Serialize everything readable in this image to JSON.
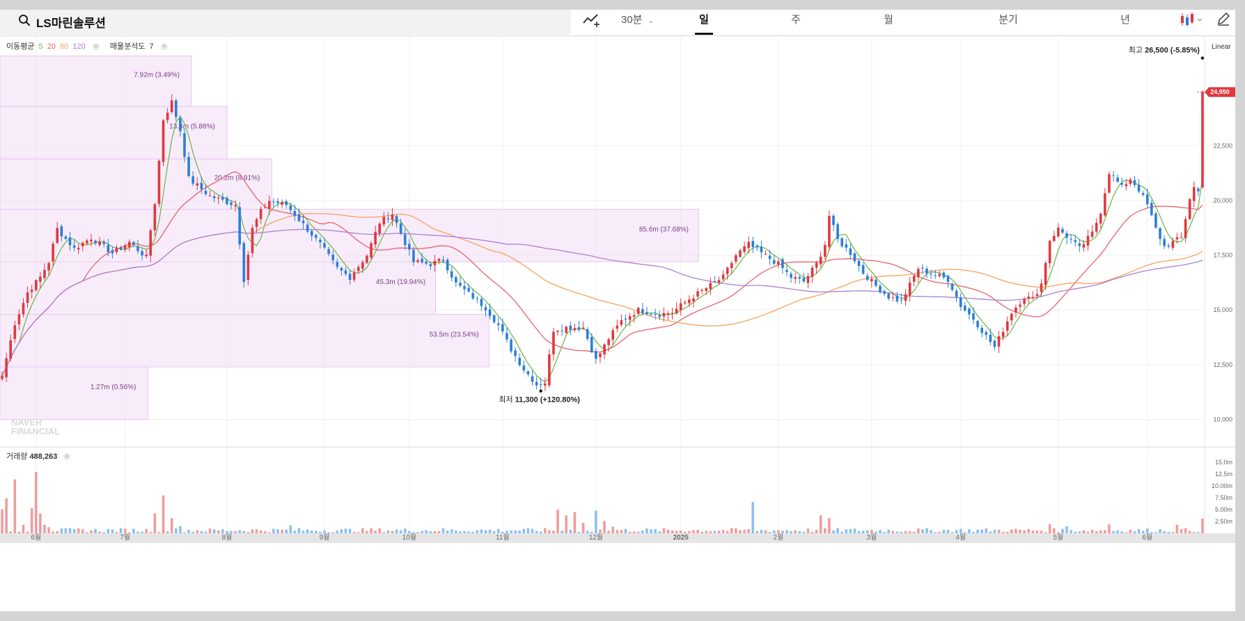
{
  "search": {
    "title": "LS마린솔루션",
    "icon": "search-icon"
  },
  "toolbar": {
    "chart_type_icon": "line-chart-icon",
    "interval": "30분",
    "periods": [
      "일",
      "주",
      "월",
      "분기",
      "년"
    ],
    "active_period": "일",
    "candle_icon": "candlestick-icon",
    "edit_icon": "pencil-icon"
  },
  "legend": {
    "ma_label": "이동평균",
    "ma_periods": [
      "5",
      "20",
      "60",
      "120"
    ],
    "profile_label": "매물분석도",
    "profile_value": "7"
  },
  "scale_label": "Linear",
  "watermark": [
    "NAVER",
    "FINANCIAL"
  ],
  "colors": {
    "up": "#e0383e",
    "down": "#2a7fd7",
    "ma5": "#6fba4e",
    "ma20": "#e8626a",
    "ma60": "#f4a35c",
    "ma120": "#ab7fd6",
    "profile": "#f3dcf6",
    "vol_up": "#ef9d9d",
    "vol_down": "#8cc0ef"
  },
  "chart_data": {
    "type": "candlestick",
    "price_ylim": [
      9000,
      27500
    ],
    "price_ticks": [
      "10,000",
      "12,500",
      "15,000",
      "17,500",
      "20,000",
      "22,500"
    ],
    "volume_ticks": [
      "2.50m",
      "5.00m",
      "7.50m",
      "10.00m",
      "12.5m",
      "15.0m"
    ],
    "volume_ylim": [
      0,
      16.5
    ],
    "x_ticks": [
      "6월",
      "7월",
      "8월",
      "9월",
      "10월",
      "11월",
      "12월",
      "2025",
      "2월",
      "3월",
      "4월",
      "5월",
      "6월"
    ],
    "current_price": "24,950",
    "high_marker": {
      "prefix": "최고",
      "value": "26,500",
      "change": "(-5.85%)",
      "price": 26500
    },
    "low_marker": {
      "prefix": "최저",
      "value": "11,300",
      "change": "(+120.80%)",
      "price": 11300
    },
    "volume_label": "거래량",
    "volume_value": "488,263",
    "volume_profile": [
      {
        "low": 10000,
        "high": 12400,
        "label": "1.27m (0.56%)",
        "share": 0.56
      },
      {
        "low": 12400,
        "high": 14800,
        "label": "53.5m (23.54%)",
        "share": 23.54
      },
      {
        "low": 14800,
        "high": 17200,
        "label": "45.3m (19.94%)",
        "share": 19.94
      },
      {
        "low": 17200,
        "high": 19600,
        "label": "85.6m (37.68%)",
        "share": 37.68
      },
      {
        "low": 19600,
        "high": 21900,
        "label": "20.2m (8.91%)",
        "share": 8.91
      },
      {
        "low": 21900,
        "high": 24300,
        "label": "13.4m (5.88%)",
        "share": 5.88
      },
      {
        "low": 24300,
        "high": 26600,
        "label": "7.92m (3.49%)",
        "share": 3.49
      }
    ],
    "price_keypoints": [
      [
        0,
        12000
      ],
      [
        3,
        14400
      ],
      [
        6,
        15800
      ],
      [
        9,
        16500
      ],
      [
        11,
        17200
      ],
      [
        13,
        18700
      ],
      [
        17,
        17800
      ],
      [
        21,
        18300
      ],
      [
        26,
        17600
      ],
      [
        30,
        18100
      ],
      [
        34,
        17400
      ],
      [
        36,
        19900
      ],
      [
        38,
        23700
      ],
      [
        40,
        24500
      ],
      [
        42,
        23200
      ],
      [
        44,
        21000
      ],
      [
        49,
        20200
      ],
      [
        55,
        19800
      ],
      [
        57,
        16400
      ],
      [
        59,
        18700
      ],
      [
        61,
        19500
      ],
      [
        63,
        20000
      ],
      [
        67,
        19800
      ],
      [
        71,
        18900
      ],
      [
        75,
        18000
      ],
      [
        79,
        16900
      ],
      [
        82,
        16500
      ],
      [
        86,
        17500
      ],
      [
        89,
        19000
      ],
      [
        92,
        19400
      ],
      [
        94,
        18500
      ],
      [
        97,
        17200
      ],
      [
        101,
        17100
      ],
      [
        104,
        17300
      ],
      [
        107,
        16200
      ],
      [
        111,
        15600
      ],
      [
        114,
        15100
      ],
      [
        117,
        14300
      ],
      [
        120,
        13200
      ],
      [
        123,
        12300
      ],
      [
        126,
        11600
      ],
      [
        128,
        11700
      ],
      [
        130,
        14100
      ],
      [
        133,
        14200
      ],
      [
        137,
        14200
      ],
      [
        140,
        12700
      ],
      [
        143,
        13700
      ],
      [
        146,
        14500
      ],
      [
        150,
        15000
      ],
      [
        155,
        14800
      ],
      [
        158,
        14900
      ],
      [
        162,
        15500
      ],
      [
        166,
        16000
      ],
      [
        170,
        16500
      ],
      [
        173,
        17500
      ],
      [
        176,
        18000
      ],
      [
        179,
        17600
      ],
      [
        183,
        17100
      ],
      [
        186,
        16500
      ],
      [
        189,
        16300
      ],
      [
        192,
        17100
      ],
      [
        194,
        18000
      ],
      [
        195,
        19300
      ],
      [
        197,
        18200
      ],
      [
        200,
        17600
      ],
      [
        203,
        16700
      ],
      [
        206,
        16100
      ],
      [
        209,
        15600
      ],
      [
        212,
        15400
      ],
      [
        216,
        16900
      ],
      [
        220,
        16600
      ],
      [
        223,
        16400
      ],
      [
        226,
        15200
      ],
      [
        229,
        14600
      ],
      [
        232,
        13800
      ],
      [
        234,
        13300
      ],
      [
        236,
        14100
      ],
      [
        238,
        14900
      ],
      [
        241,
        15600
      ],
      [
        243,
        15500
      ],
      [
        245,
        16200
      ],
      [
        247,
        18200
      ],
      [
        249,
        18700
      ],
      [
        252,
        18200
      ],
      [
        254,
        17800
      ],
      [
        257,
        18500
      ],
      [
        259,
        19500
      ],
      [
        261,
        21300
      ],
      [
        264,
        20600
      ],
      [
        266,
        21000
      ],
      [
        268,
        20500
      ],
      [
        270,
        19800
      ],
      [
        272,
        18700
      ],
      [
        274,
        17900
      ],
      [
        276,
        18100
      ],
      [
        278,
        18300
      ],
      [
        280,
        20100
      ],
      [
        281,
        20600
      ],
      [
        282,
        20400
      ],
      [
        283,
        24950
      ]
    ],
    "volume_spikes": [
      [
        0,
        5.1
      ],
      [
        1,
        7.4
      ],
      [
        3,
        11.4
      ],
      [
        5,
        1.8
      ],
      [
        7,
        5.3
      ],
      [
        8,
        13.0
      ],
      [
        9,
        4.2
      ],
      [
        10,
        1.8
      ],
      [
        11,
        1.3
      ],
      [
        36,
        4.2
      ],
      [
        38,
        8.0
      ],
      [
        40,
        3.2
      ],
      [
        42,
        1.5
      ],
      [
        68,
        1.7
      ],
      [
        131,
        5.0
      ],
      [
        133,
        3.8
      ],
      [
        135,
        4.5
      ],
      [
        137,
        2.2
      ],
      [
        140,
        4.8
      ],
      [
        142,
        2.6
      ],
      [
        144,
        1.4
      ],
      [
        177,
        6.6
      ],
      [
        193,
        3.8
      ],
      [
        195,
        3.2
      ],
      [
        247,
        1.9
      ],
      [
        251,
        1.5
      ],
      [
        261,
        1.9
      ],
      [
        277,
        1.8
      ],
      [
        283,
        3.1
      ]
    ]
  }
}
